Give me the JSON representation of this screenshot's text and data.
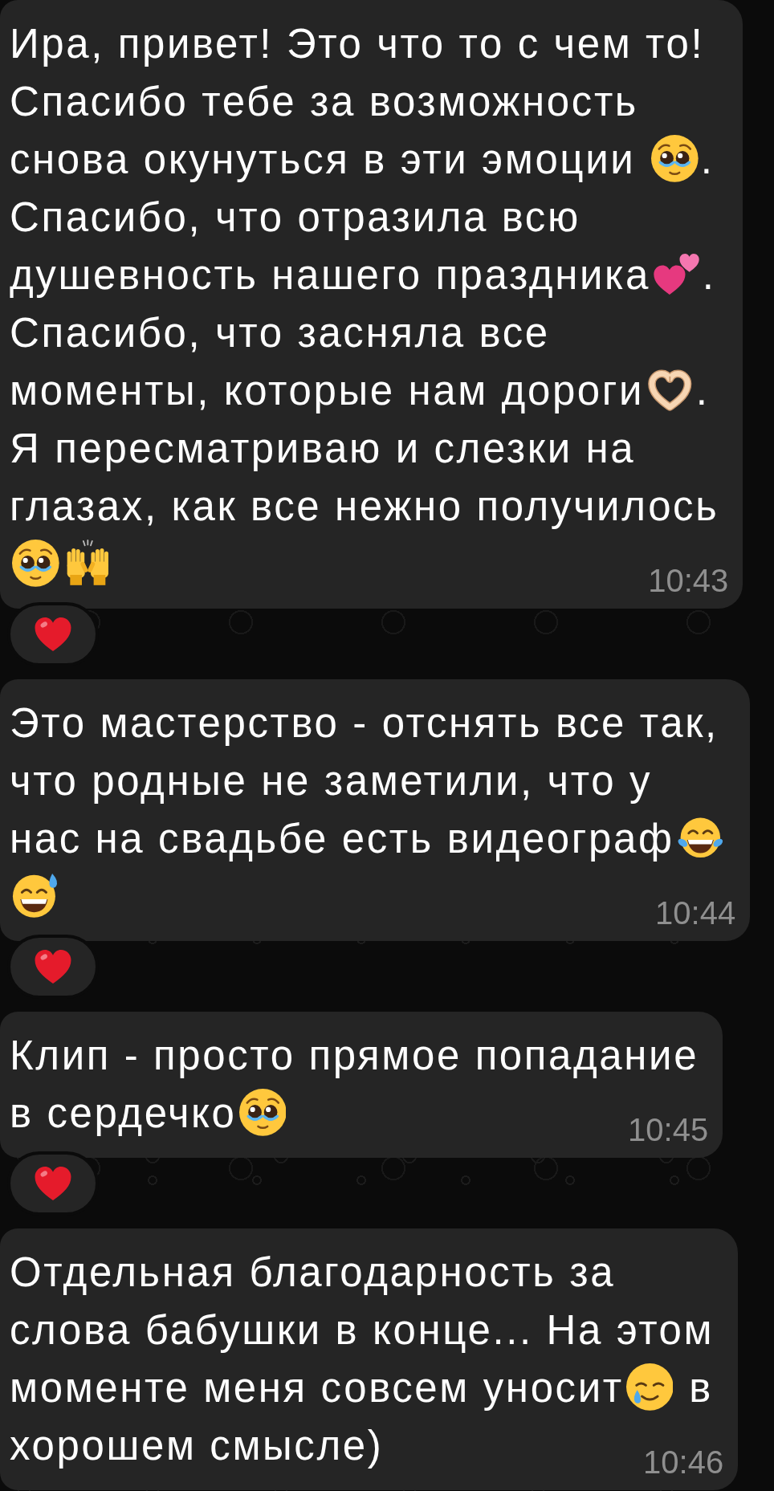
{
  "messages": [
    {
      "lines": [
        [
          {
            "kind": "text",
            "text": "Ира, привет! Это что то с чем то!"
          }
        ],
        [
          {
            "kind": "text",
            "text": "Спасибо тебе за возможность"
          }
        ],
        [
          {
            "kind": "text",
            "text": "снова окунуться в эти эмоции "
          },
          {
            "kind": "pleading"
          },
          {
            "kind": "text",
            "text": "."
          }
        ],
        [
          {
            "kind": "text",
            "text": "Спасибо, что отразила всю"
          }
        ],
        [
          {
            "kind": "text",
            "text": "душевность нашего праздника"
          },
          {
            "kind": "hearts"
          },
          {
            "kind": "text",
            "text": "."
          }
        ],
        [
          {
            "kind": "text",
            "text": "Спасибо, что засняла все"
          }
        ],
        [
          {
            "kind": "text",
            "text": "моменты, которые нам дороги"
          },
          {
            "kind": "handheart"
          },
          {
            "kind": "text",
            "text": "."
          }
        ],
        [
          {
            "kind": "text",
            "text": "Я пересматриваю и слезки на"
          }
        ],
        [
          {
            "kind": "text",
            "text": "глазах, как все нежно получилось"
          }
        ],
        [
          {
            "kind": "pleading"
          },
          {
            "kind": "cheer"
          }
        ]
      ],
      "time": "10:43",
      "reaction": {
        "kind": "heart"
      }
    },
    {
      "lines": [
        [
          {
            "kind": "text",
            "text": "Это мастерство - отснять все так,"
          }
        ],
        [
          {
            "kind": "text",
            "text": "что родные не заметили, что у"
          }
        ],
        [
          {
            "kind": "text",
            "text": "нас на свадьбе есть видеограф"
          },
          {
            "kind": "joy"
          }
        ],
        [
          {
            "kind": "sweat"
          }
        ]
      ],
      "time": "10:44",
      "reaction": {
        "kind": "heart"
      }
    },
    {
      "lines": [
        [
          {
            "kind": "text",
            "text": "Клип - просто прямое попадание"
          }
        ],
        [
          {
            "kind": "text",
            "text": "в сердечко"
          },
          {
            "kind": "pleading"
          }
        ]
      ],
      "time": "10:45",
      "reaction": {
        "kind": "heart"
      }
    },
    {
      "lines": [
        [
          {
            "kind": "text",
            "text": "Отдельная благодарность за"
          }
        ],
        [
          {
            "kind": "text",
            "text": "слова бабушки в конце... На этом"
          }
        ],
        [
          {
            "kind": "text",
            "text": "моменте меня совсем уносит"
          },
          {
            "kind": "tear"
          },
          {
            "kind": "text",
            "text": " в"
          }
        ],
        [
          {
            "kind": "text",
            "text": "хорошем смысле)"
          }
        ]
      ],
      "time": "10:46"
    }
  ]
}
